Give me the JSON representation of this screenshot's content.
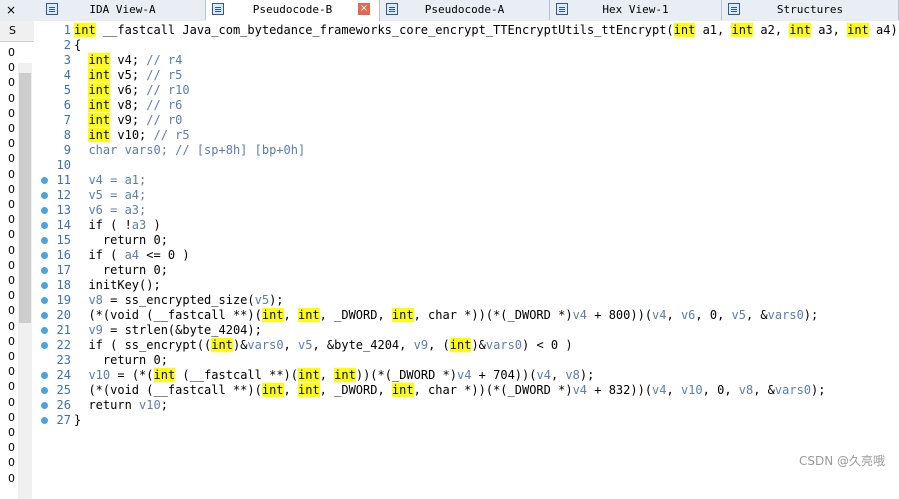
{
  "tabs": [
    {
      "label": "IDA View-A",
      "active": false,
      "closable": false
    },
    {
      "label": "Pseudocode-B",
      "active": true,
      "closable": true
    },
    {
      "label": "Pseudocode-A",
      "active": false,
      "closable": true
    },
    {
      "label": "Hex View-1",
      "active": false,
      "closable": true
    },
    {
      "label": "Structures",
      "active": false,
      "closable": true
    }
  ],
  "left_panel": {
    "tab_close": "×",
    "header": "S",
    "rows": [
      "0",
      "0",
      "0",
      "0",
      "0",
      "0",
      "0",
      "0",
      "0",
      "0",
      "0",
      "0",
      "0",
      "0",
      "0",
      "0",
      "0",
      "0",
      "0",
      "0",
      "0",
      "0",
      "0",
      "0",
      "0",
      "0",
      "0",
      "0",
      "0"
    ]
  },
  "code_lines": [
    {
      "n": "1",
      "dot": false,
      "html": "<span class='hl'>int</span> __fastcall Java_com_bytedance_frameworks_core_encrypt_TTEncryptUtils_ttEncrypt(<span class='hl'>int</span> a1, <span class='hl'>int</span> a2, <span class='hl'>int</span> a3, <span class='hl'>int</span> a4)"
    },
    {
      "n": "2",
      "dot": false,
      "html": "{"
    },
    {
      "n": "3",
      "dot": false,
      "html": "  <span class='hl'>int</span> v4; <span class='comment'>// r4</span>"
    },
    {
      "n": "4",
      "dot": false,
      "html": "  <span class='hl'>int</span> v5; <span class='comment'>// r5</span>"
    },
    {
      "n": "5",
      "dot": false,
      "html": "  <span class='hl'>int</span> v6; <span class='comment'>// r10</span>"
    },
    {
      "n": "6",
      "dot": false,
      "html": "  <span class='hl'>int</span> v8; <span class='comment'>// r6</span>"
    },
    {
      "n": "7",
      "dot": false,
      "html": "  <span class='hl'>int</span> v9; <span class='comment'>// r0</span>"
    },
    {
      "n": "8",
      "dot": false,
      "html": "  <span class='hl'>int</span> v10; <span class='comment'>// r5</span>"
    },
    {
      "n": "9",
      "dot": false,
      "html": "  <span class='comment'>char vars0; // [sp+8h] [bp+0h]</span>"
    },
    {
      "n": "10",
      "dot": false,
      "html": ""
    },
    {
      "n": "11",
      "dot": true,
      "html": "  <span class='comment'>v4 = a1;</span>"
    },
    {
      "n": "12",
      "dot": true,
      "html": "  <span class='comment'>v5 = a4;</span>"
    },
    {
      "n": "13",
      "dot": true,
      "html": "  <span class='comment'>v6 = a3;</span>"
    },
    {
      "n": "14",
      "dot": true,
      "html": "  if ( !<span class='comment'>a3</span> )"
    },
    {
      "n": "15",
      "dot": true,
      "html": "    return 0;"
    },
    {
      "n": "16",
      "dot": true,
      "html": "  if ( <span class='comment'>a4</span> &lt;= 0 )"
    },
    {
      "n": "17",
      "dot": true,
      "html": "    return 0;"
    },
    {
      "n": "18",
      "dot": true,
      "html": "  initKey();"
    },
    {
      "n": "19",
      "dot": true,
      "html": "  <span class='comment'>v8</span> = ss_encrypted_size(<span class='comment'>v5</span>);"
    },
    {
      "n": "20",
      "dot": true,
      "html": "  (*(void (__fastcall **)(<span class='hl'>int</span>, <span class='hl'>int</span>, _DWORD, <span class='hl'>int</span>, char *))(*(_DWORD *)<span class='comment'>v4</span> + 800))(<span class='comment'>v4</span>, <span class='comment'>v6</span>, 0, <span class='comment'>v5</span>, &amp;<span class='comment'>vars0</span>);"
    },
    {
      "n": "21",
      "dot": true,
      "html": "  <span class='comment'>v9</span> = strlen(&amp;byte_4204);"
    },
    {
      "n": "22",
      "dot": true,
      "html": "  if ( ss_encrypt((<span class='hl'>int</span>)&amp;<span class='comment'>vars0</span>, <span class='comment'>v5</span>, &amp;byte_4204, <span class='comment'>v9</span>, (<span class='hl'>int</span>)&amp;<span class='comment'>vars0</span>) &lt; 0 )"
    },
    {
      "n": "23",
      "dot": false,
      "html": "    return 0;"
    },
    {
      "n": "24",
      "dot": true,
      "html": "  <span class='comment'>v10</span> = (*(<span class='hl'>int</span> (__fastcall **)(<span class='hl'>int</span>, <span class='hl'>int</span>))(*(_DWORD *)<span class='comment'>v4</span> + 704))(<span class='comment'>v4</span>, <span class='comment'>v8</span>);"
    },
    {
      "n": "25",
      "dot": true,
      "html": "  (*(void (__fastcall **)(<span class='hl'>int</span>, <span class='hl'>int</span>, _DWORD, <span class='hl'>int</span>, char *))(*(_DWORD *)<span class='comment'>v4</span> + 832))(<span class='comment'>v4</span>, <span class='comment'>v10</span>, 0, <span class='comment'>v8</span>, &amp;<span class='comment'>vars0</span>);"
    },
    {
      "n": "26",
      "dot": true,
      "html": "  return <span class='comment'>v10</span>;"
    },
    {
      "n": "27",
      "dot": true,
      "html": "}"
    }
  ],
  "watermark": "CSDN @久亮哦",
  "colors": {
    "highlight": "#ffff00",
    "line_numbers": "#3c6fb4",
    "breakpoint_dot": "#4aa3df",
    "close_button": "#e0694f"
  }
}
